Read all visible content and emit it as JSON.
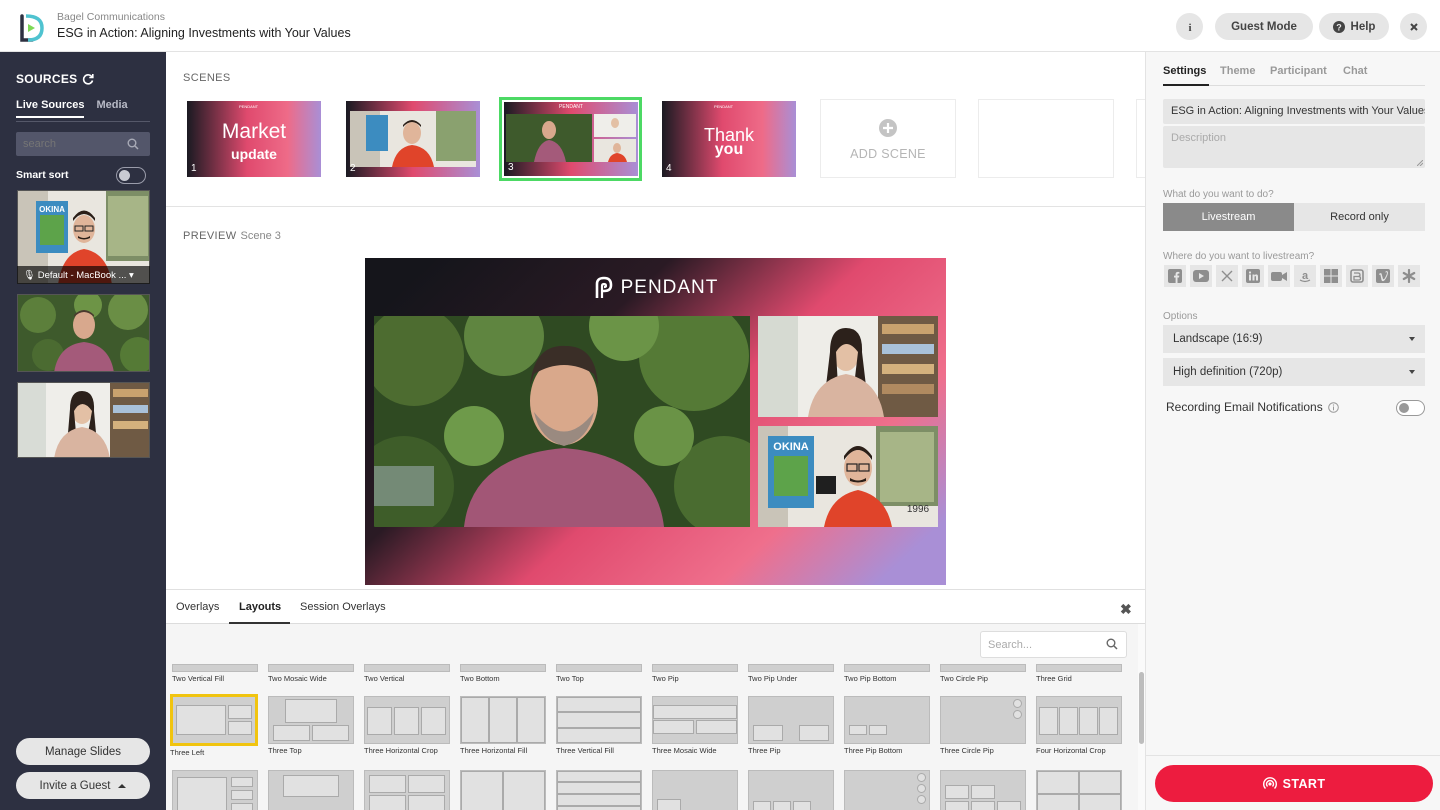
{
  "header": {
    "org": "Bagel Communications",
    "title": "ESG in Action: Aligning Investments with Your Values",
    "guest_mode": "Guest Mode",
    "help": "Help"
  },
  "sidebar": {
    "title": "SOURCES",
    "tabs": [
      "Live Sources",
      "Media"
    ],
    "search_placeholder": "search",
    "smart_sort": "Smart sort",
    "source_label": "Default - MacBook ...",
    "manage_slides": "Manage Slides",
    "invite_guest": "Invite a Guest"
  },
  "scenes": {
    "label": "SCENES",
    "items": [
      {
        "num": "1",
        "line1": "Market",
        "line2": "update"
      },
      {
        "num": "2"
      },
      {
        "num": "3"
      },
      {
        "num": "4",
        "line1": "Thank",
        "line2": "you"
      }
    ],
    "add_scene": "ADD SCENE",
    "thumb_brand": "PENDANT"
  },
  "preview": {
    "label": "PREVIEW",
    "scene": "Scene 3",
    "brand": "PENDANT"
  },
  "bottom": {
    "tabs": [
      "Overlays",
      "Layouts",
      "Session Overlays"
    ],
    "search_placeholder": "Search...",
    "row1": [
      "Two Vertical Fill",
      "Two Mosaic Wide",
      "Two Vertical",
      "Two Bottom",
      "Two Top",
      "Two Pip",
      "Two Pip Under",
      "Two Pip Bottom",
      "Two Circle Pip",
      "Three Grid"
    ],
    "row2": [
      "Three Left",
      "Three Top",
      "Three Horizontal Crop",
      "Three Horizontal Fill",
      "Three Vertical Fill",
      "Three Mosaic Wide",
      "Three Pip",
      "Three Pip Bottom",
      "Three Circle Pip",
      "Four Horizontal Crop"
    ]
  },
  "right": {
    "tabs": [
      "Settings",
      "Theme",
      "Participant",
      "Chat"
    ],
    "title_value": "ESG in Action: Aligning Investments with Your Values",
    "description_placeholder": "Description",
    "q_do": "What do you want to do?",
    "livestream": "Livestream",
    "record_only": "Record only",
    "q_where": "Where do you want to livestream?",
    "options_label": "Options",
    "aspect": "Landscape (16:9)",
    "quality": "High definition (720p)",
    "rec_email": "Recording Email Notifications",
    "start": "START",
    "social_icons": [
      "facebook-icon",
      "youtube-icon",
      "x-icon",
      "linkedin-icon",
      "zoom-icon",
      "amazon-icon",
      "microsoft-icon",
      "brightcove-icon",
      "vimeo-icon",
      "custom-rtmp-icon"
    ]
  },
  "colors": {
    "accent_red": "#ed1c3f",
    "selected_green": "#4cd964",
    "selected_layout": "#f1c40f",
    "sidebar_bg": "#2d3041"
  }
}
